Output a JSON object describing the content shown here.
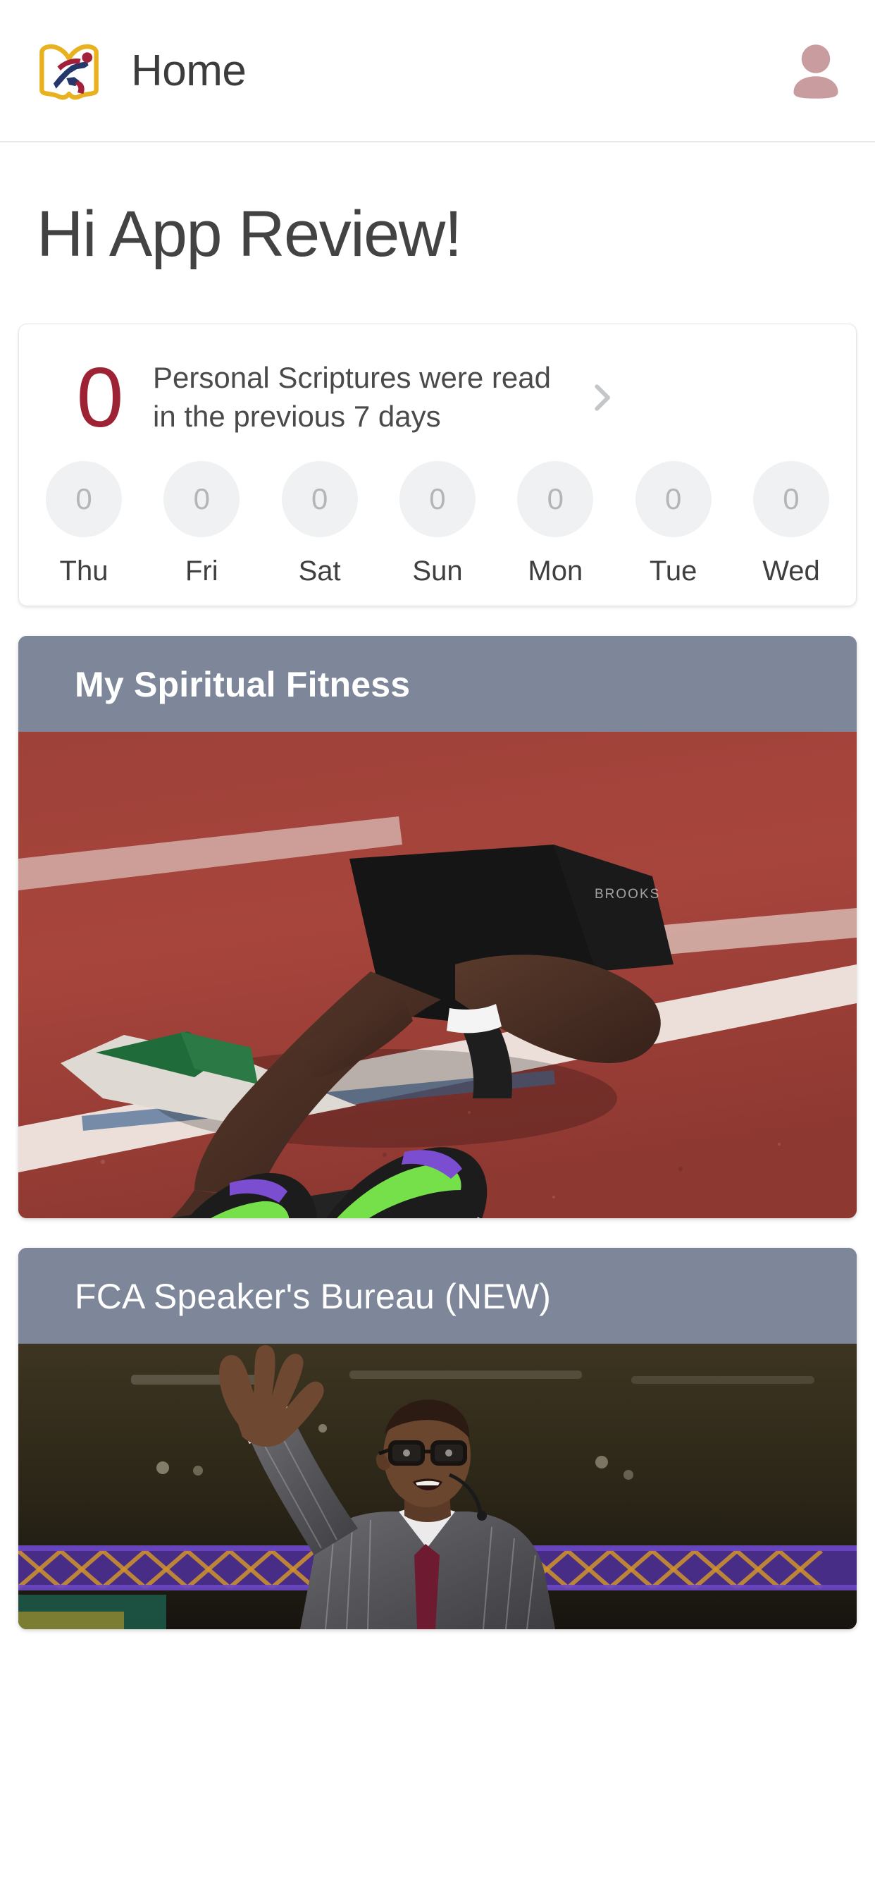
{
  "header": {
    "logo_icon": "fca-book-runner-logo",
    "title": "Home",
    "avatar_icon": "user-avatar-icon",
    "avatar_color": "#c99ca0"
  },
  "greeting": "Hi App Review!",
  "scripture_card": {
    "count": "0",
    "count_color": "#9c2234",
    "description": "Personal Scriptures were read in the previous 7 days",
    "chevron_icon": "chevron-right-icon",
    "week": [
      {
        "label": "Thu",
        "value": "0"
      },
      {
        "label": "Fri",
        "value": "0"
      },
      {
        "label": "Sat",
        "value": "0"
      },
      {
        "label": "Sun",
        "value": "0"
      },
      {
        "label": "Mon",
        "value": "0"
      },
      {
        "label": "Tue",
        "value": "0"
      },
      {
        "label": "Wed",
        "value": "0"
      }
    ]
  },
  "feature_cards": [
    {
      "title": "My Spiritual Fitness",
      "header_color": "#7d8799",
      "image_alt": "sprinter-in-starting-blocks-on-red-track"
    },
    {
      "title": "FCA Speaker's Bureau (NEW)",
      "header_color": "#7d8799",
      "image_alt": "speaker-with-raised-hand-on-stage"
    }
  ]
}
